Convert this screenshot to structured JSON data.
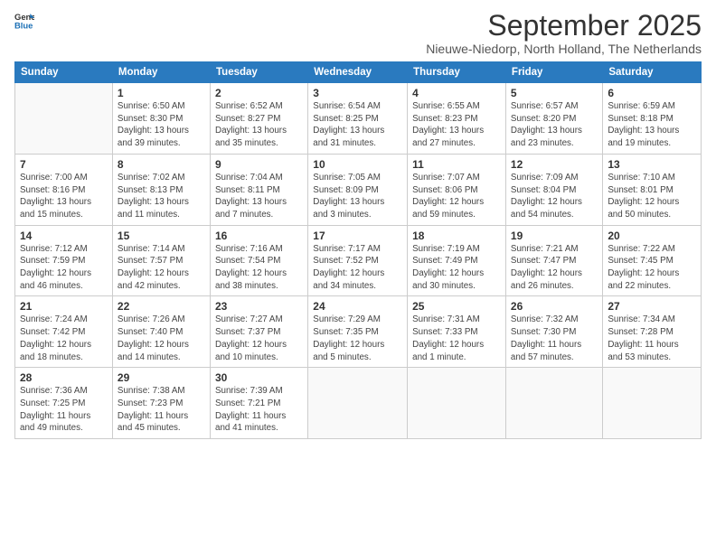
{
  "logo": {
    "line1": "General",
    "line2": "Blue"
  },
  "title": "September 2025",
  "location": "Nieuwe-Niedorp, North Holland, The Netherlands",
  "days_of_week": [
    "Sunday",
    "Monday",
    "Tuesday",
    "Wednesday",
    "Thursday",
    "Friday",
    "Saturday"
  ],
  "weeks": [
    [
      {
        "day": "",
        "info": ""
      },
      {
        "day": "1",
        "info": "Sunrise: 6:50 AM\nSunset: 8:30 PM\nDaylight: 13 hours\nand 39 minutes."
      },
      {
        "day": "2",
        "info": "Sunrise: 6:52 AM\nSunset: 8:27 PM\nDaylight: 13 hours\nand 35 minutes."
      },
      {
        "day": "3",
        "info": "Sunrise: 6:54 AM\nSunset: 8:25 PM\nDaylight: 13 hours\nand 31 minutes."
      },
      {
        "day": "4",
        "info": "Sunrise: 6:55 AM\nSunset: 8:23 PM\nDaylight: 13 hours\nand 27 minutes."
      },
      {
        "day": "5",
        "info": "Sunrise: 6:57 AM\nSunset: 8:20 PM\nDaylight: 13 hours\nand 23 minutes."
      },
      {
        "day": "6",
        "info": "Sunrise: 6:59 AM\nSunset: 8:18 PM\nDaylight: 13 hours\nand 19 minutes."
      }
    ],
    [
      {
        "day": "7",
        "info": "Sunrise: 7:00 AM\nSunset: 8:16 PM\nDaylight: 13 hours\nand 15 minutes."
      },
      {
        "day": "8",
        "info": "Sunrise: 7:02 AM\nSunset: 8:13 PM\nDaylight: 13 hours\nand 11 minutes."
      },
      {
        "day": "9",
        "info": "Sunrise: 7:04 AM\nSunset: 8:11 PM\nDaylight: 13 hours\nand 7 minutes."
      },
      {
        "day": "10",
        "info": "Sunrise: 7:05 AM\nSunset: 8:09 PM\nDaylight: 13 hours\nand 3 minutes."
      },
      {
        "day": "11",
        "info": "Sunrise: 7:07 AM\nSunset: 8:06 PM\nDaylight: 12 hours\nand 59 minutes."
      },
      {
        "day": "12",
        "info": "Sunrise: 7:09 AM\nSunset: 8:04 PM\nDaylight: 12 hours\nand 54 minutes."
      },
      {
        "day": "13",
        "info": "Sunrise: 7:10 AM\nSunset: 8:01 PM\nDaylight: 12 hours\nand 50 minutes."
      }
    ],
    [
      {
        "day": "14",
        "info": "Sunrise: 7:12 AM\nSunset: 7:59 PM\nDaylight: 12 hours\nand 46 minutes."
      },
      {
        "day": "15",
        "info": "Sunrise: 7:14 AM\nSunset: 7:57 PM\nDaylight: 12 hours\nand 42 minutes."
      },
      {
        "day": "16",
        "info": "Sunrise: 7:16 AM\nSunset: 7:54 PM\nDaylight: 12 hours\nand 38 minutes."
      },
      {
        "day": "17",
        "info": "Sunrise: 7:17 AM\nSunset: 7:52 PM\nDaylight: 12 hours\nand 34 minutes."
      },
      {
        "day": "18",
        "info": "Sunrise: 7:19 AM\nSunset: 7:49 PM\nDaylight: 12 hours\nand 30 minutes."
      },
      {
        "day": "19",
        "info": "Sunrise: 7:21 AM\nSunset: 7:47 PM\nDaylight: 12 hours\nand 26 minutes."
      },
      {
        "day": "20",
        "info": "Sunrise: 7:22 AM\nSunset: 7:45 PM\nDaylight: 12 hours\nand 22 minutes."
      }
    ],
    [
      {
        "day": "21",
        "info": "Sunrise: 7:24 AM\nSunset: 7:42 PM\nDaylight: 12 hours\nand 18 minutes."
      },
      {
        "day": "22",
        "info": "Sunrise: 7:26 AM\nSunset: 7:40 PM\nDaylight: 12 hours\nand 14 minutes."
      },
      {
        "day": "23",
        "info": "Sunrise: 7:27 AM\nSunset: 7:37 PM\nDaylight: 12 hours\nand 10 minutes."
      },
      {
        "day": "24",
        "info": "Sunrise: 7:29 AM\nSunset: 7:35 PM\nDaylight: 12 hours\nand 5 minutes."
      },
      {
        "day": "25",
        "info": "Sunrise: 7:31 AM\nSunset: 7:33 PM\nDaylight: 12 hours\nand 1 minute."
      },
      {
        "day": "26",
        "info": "Sunrise: 7:32 AM\nSunset: 7:30 PM\nDaylight: 11 hours\nand 57 minutes."
      },
      {
        "day": "27",
        "info": "Sunrise: 7:34 AM\nSunset: 7:28 PM\nDaylight: 11 hours\nand 53 minutes."
      }
    ],
    [
      {
        "day": "28",
        "info": "Sunrise: 7:36 AM\nSunset: 7:25 PM\nDaylight: 11 hours\nand 49 minutes."
      },
      {
        "day": "29",
        "info": "Sunrise: 7:38 AM\nSunset: 7:23 PM\nDaylight: 11 hours\nand 45 minutes."
      },
      {
        "day": "30",
        "info": "Sunrise: 7:39 AM\nSunset: 7:21 PM\nDaylight: 11 hours\nand 41 minutes."
      },
      {
        "day": "",
        "info": ""
      },
      {
        "day": "",
        "info": ""
      },
      {
        "day": "",
        "info": ""
      },
      {
        "day": "",
        "info": ""
      }
    ]
  ]
}
